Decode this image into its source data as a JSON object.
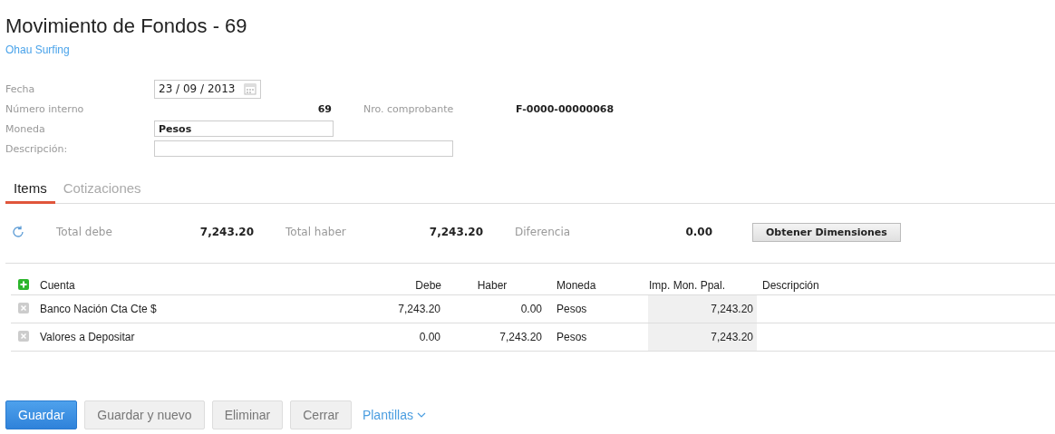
{
  "title": "Movimiento de Fondos - 69",
  "subtitle": "Ohau Surfing",
  "form": {
    "fecha": {
      "label": "Fecha",
      "value": "23 / 09 / 2013"
    },
    "numero": {
      "label": "Número interno",
      "value": "69"
    },
    "comprobante": {
      "label": "Nro. comprobante",
      "value": "F-0000-00000068"
    },
    "moneda": {
      "label": "Moneda",
      "value": "Pesos"
    },
    "descripcion": {
      "label": "Descripción:"
    }
  },
  "tabs": [
    {
      "label": "Items",
      "selected": true
    },
    {
      "label": "Cotizaciones",
      "selected": false
    }
  ],
  "totals": [
    {
      "label": "Total debe",
      "value": "7,243.20"
    },
    {
      "label": "Total haber",
      "value": "7,243.20"
    },
    {
      "label": "Diferencia",
      "value": "0.00"
    }
  ],
  "dimensions_button": "Obtener Dimensiones",
  "table": {
    "columns": [
      "Cuenta",
      "Debe",
      "Haber",
      "Moneda",
      "Imp. Mon. Ppal.",
      "Descripción"
    ],
    "rows": [
      [
        "Banco Nación Cta Cte $",
        "7,243.20",
        "0.00",
        "Pesos",
        "7,243.20"
      ],
      [
        "Valores a Depositar",
        "0.00",
        "7,243.20",
        "Pesos",
        "7,243.20"
      ]
    ]
  },
  "buttons": [
    {
      "label": "Guardar",
      "kind": "primary"
    },
    {
      "label": "Guardar y nuevo",
      "kind": "default"
    },
    {
      "label": "Eliminar",
      "kind": "default"
    },
    {
      "label": "Cerrar",
      "kind": "default"
    },
    {
      "label": "Plantillas",
      "kind": "dropdown"
    }
  ]
}
